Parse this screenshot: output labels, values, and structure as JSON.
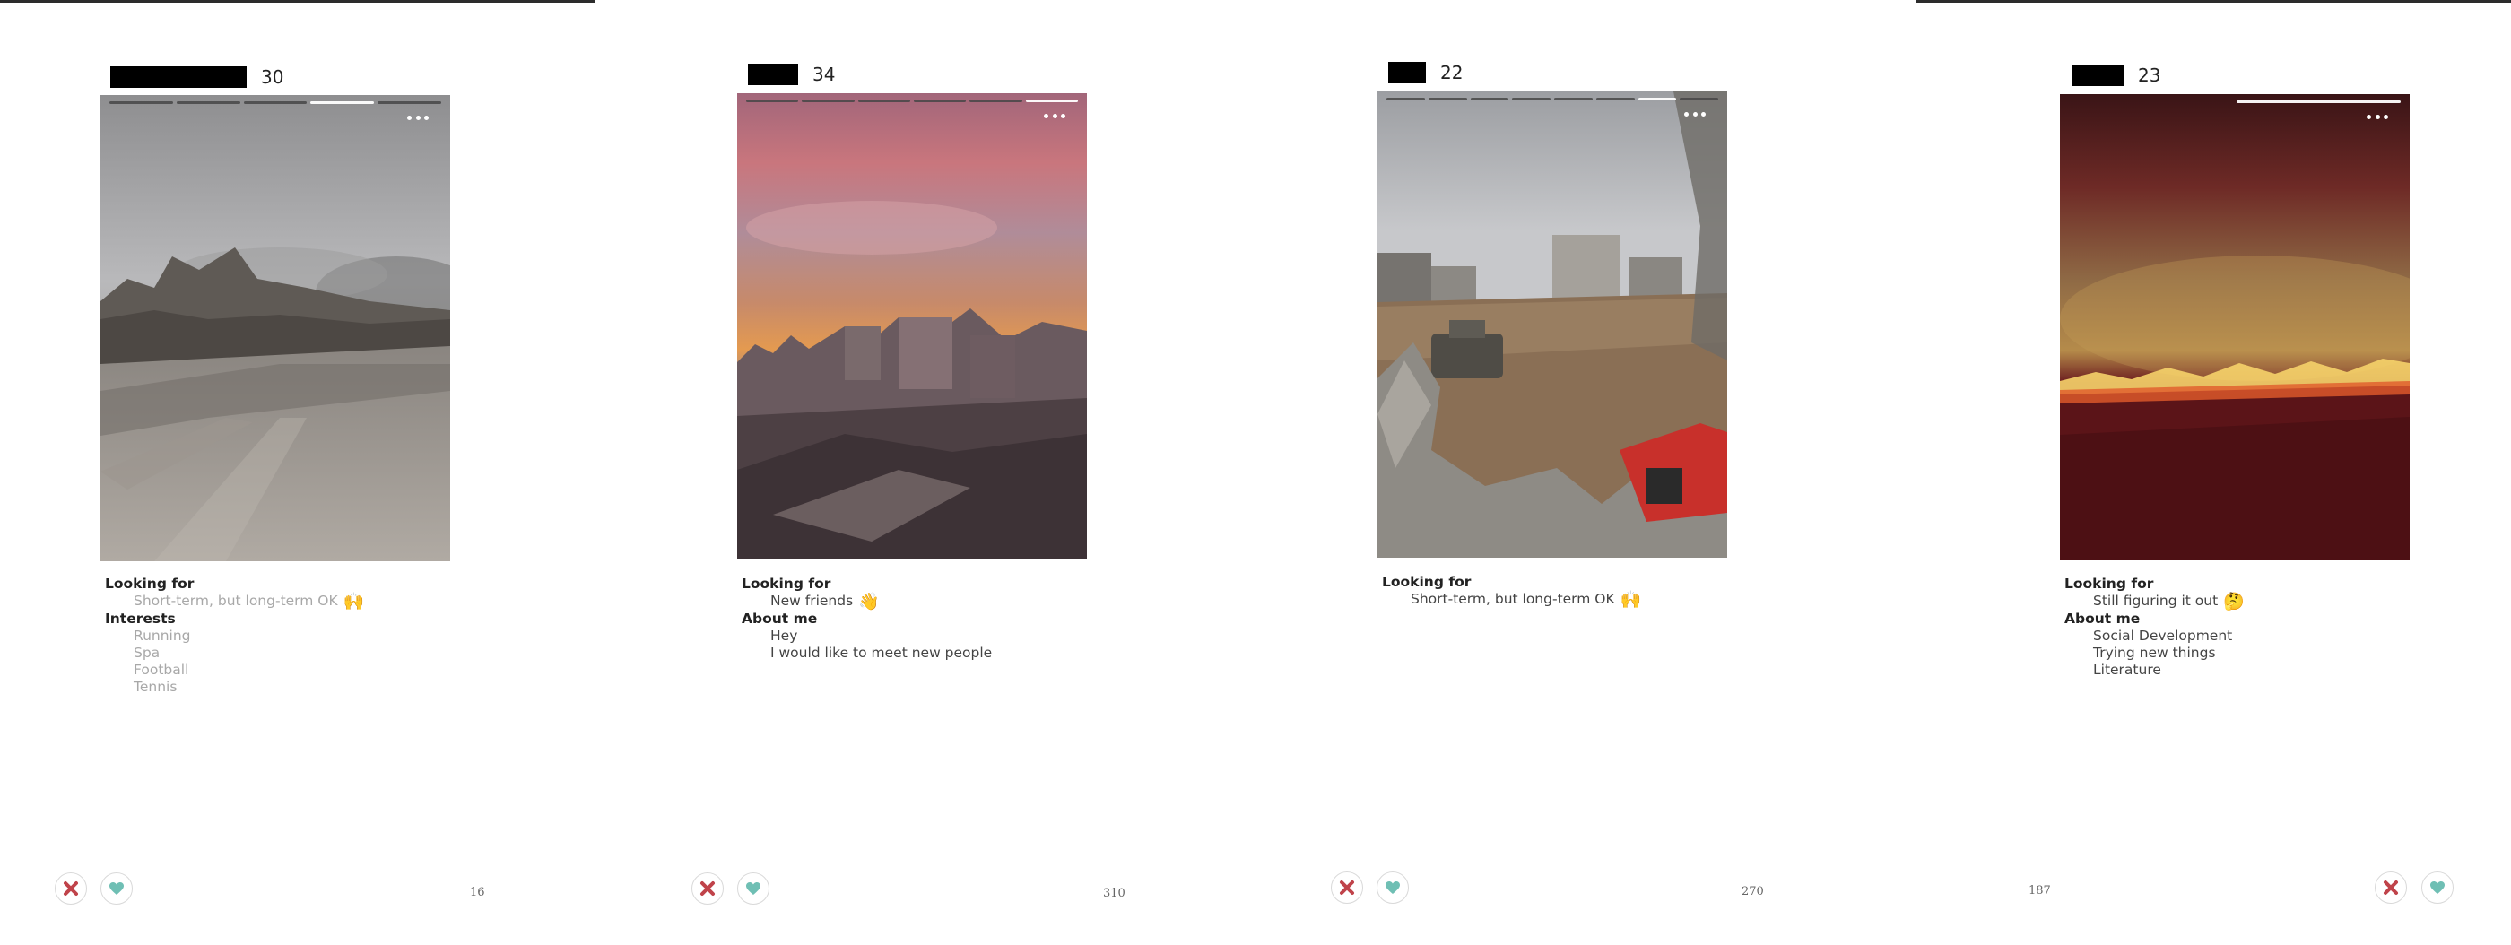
{
  "cards": [
    {
      "age": "30",
      "sections": [
        {
          "heading": "Looking for",
          "items": [
            "Short-term, but long-term OK"
          ],
          "emoji": "🙌"
        },
        {
          "heading": "Interests",
          "items": [
            "Running",
            "Spa",
            "Football",
            "Tennis"
          ]
        }
      ],
      "count": "16",
      "photo_progress": {
        "segments": 5,
        "active": 4
      }
    },
    {
      "age": "34",
      "sections": [
        {
          "heading": "Looking for",
          "items": [
            "New friends"
          ],
          "emoji": "👋"
        },
        {
          "heading": "About me",
          "items": [
            "Hey",
            "I would like to meet new people"
          ]
        }
      ],
      "count": "310",
      "photo_progress": {
        "segments": 6,
        "active": 6
      }
    },
    {
      "age": "22",
      "sections": [
        {
          "heading": "Looking for",
          "items": [
            "Short-term, but long-term OK"
          ],
          "emoji": "🙌"
        }
      ],
      "count": "270",
      "photo_progress": {
        "segments": 8,
        "active": 7
      }
    },
    {
      "age": "23",
      "sections": [
        {
          "heading": "Looking for",
          "items": [
            "Still figuring it out"
          ],
          "emoji": "🤔"
        },
        {
          "heading": "About me",
          "items": [
            "Social Development",
            "Trying new things",
            "Literature"
          ]
        }
      ],
      "count": "187",
      "photo_progress": {
        "segments": 2,
        "active": 2
      }
    }
  ],
  "icons": {
    "more": "more-options-icon",
    "pass": "close-x-icon",
    "like": "heart-icon"
  },
  "colors": {
    "pass": "#c0434a",
    "like": "#6fbfb4",
    "button_border": "#d9d9d9"
  }
}
